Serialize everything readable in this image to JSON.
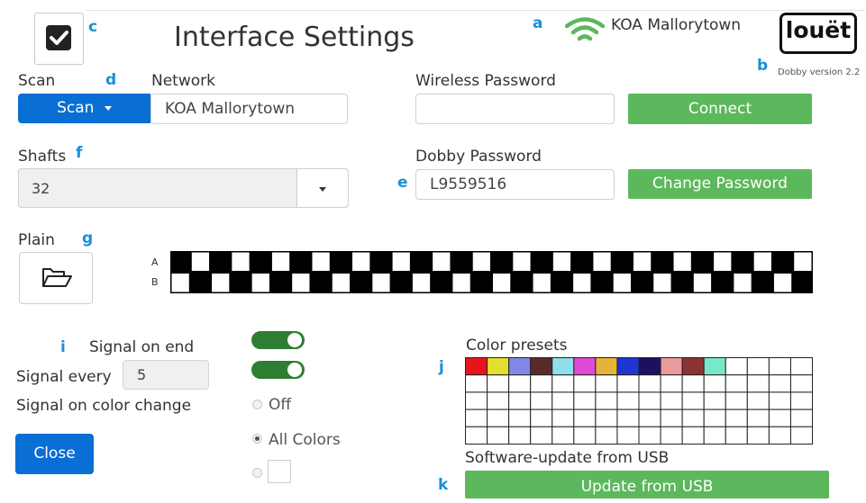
{
  "header": {
    "title": "Interface Settings",
    "network_name": "KOA Mallorytown",
    "brand": "louët",
    "version": "Dobby version 2.2"
  },
  "annotations": {
    "a": "a",
    "b": "b",
    "c": "c",
    "d": "d",
    "e": "e",
    "f": "f",
    "g": "g",
    "i": "i",
    "j": "j",
    "k": "k"
  },
  "network": {
    "scan_label": "Scan",
    "scan_button": "Scan",
    "network_label": "Network",
    "network_value": "KOA Mallorytown"
  },
  "wireless": {
    "label": "Wireless Password",
    "value": "",
    "connect_button": "Connect"
  },
  "shafts": {
    "label": "Shafts",
    "value": "32"
  },
  "dobby": {
    "label": "Dobby Password",
    "value": "L9559516",
    "change_button": "Change Password"
  },
  "pattern": {
    "label": "Plain",
    "row_labels": [
      "A",
      "B"
    ],
    "columns": 32
  },
  "signals": {
    "on_end_label": "Signal on end",
    "every_label": "Signal every",
    "every_value": "5",
    "color_change_label": "Signal on color change",
    "on_end_enabled": true,
    "every_enabled": true,
    "options": [
      "Off",
      "All Colors",
      ""
    ],
    "selected_option": "All Colors",
    "close_button": "Close"
  },
  "color_presets": {
    "label": "Color presets",
    "columns": 16,
    "rows": 5,
    "first_row_colors": [
      "#e8141b",
      "#e4de2e",
      "#8189e6",
      "#5a2a2a",
      "#8fe0e8",
      "#e04ad6",
      "#e6b23a",
      "#1f35d4",
      "#1c1160",
      "#e99a9a",
      "#8b3232",
      "#78e8c8"
    ]
  },
  "update": {
    "label": "Software-update from USB",
    "button": "Update from USB"
  },
  "colors": {
    "primary_blue": "#0a6fd4",
    "success_green": "#5cb85c",
    "toggle_green": "#2e7d32",
    "annotation_blue": "#1a8fd8"
  }
}
